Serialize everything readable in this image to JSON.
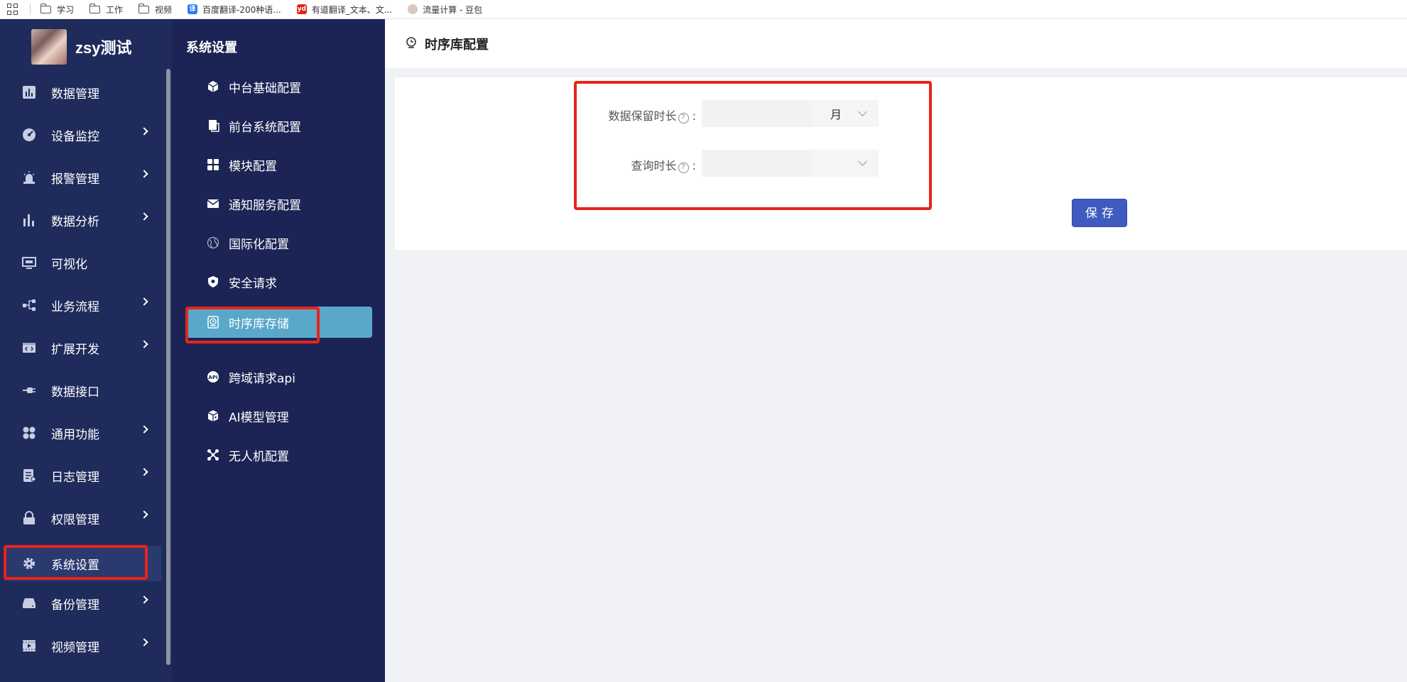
{
  "bookmarks": [
    {
      "label": "学习",
      "icon": "folder-icon"
    },
    {
      "label": "工作",
      "icon": "folder-icon"
    },
    {
      "label": "视频",
      "icon": "folder-icon"
    },
    {
      "label": "百度翻译-200种语...",
      "icon": "baidu-translate-icon"
    },
    {
      "label": "有道翻译_文本、文...",
      "icon": "youdao-icon"
    },
    {
      "label": "流量计算 - 豆包",
      "icon": "doubao-icon"
    }
  ],
  "brand": {
    "name": "zsy测试"
  },
  "sidebar": {
    "items": [
      {
        "label": "数据管理",
        "icon": "bar-chart-icon",
        "has_children": false
      },
      {
        "label": "设备监控",
        "icon": "gauge-icon",
        "has_children": true
      },
      {
        "label": "报警管理",
        "icon": "alarm-icon",
        "has_children": true
      },
      {
        "label": "数据分析",
        "icon": "analytics-icon",
        "has_children": true
      },
      {
        "label": "可视化",
        "icon": "monitor-icon",
        "has_children": false
      },
      {
        "label": "业务流程",
        "icon": "flow-icon",
        "has_children": true
      },
      {
        "label": "扩展开发",
        "icon": "code-icon",
        "has_children": true
      },
      {
        "label": "数据接口",
        "icon": "plug-icon",
        "has_children": false
      },
      {
        "label": "通用功能",
        "icon": "grid-icon",
        "has_children": true
      },
      {
        "label": "日志管理",
        "icon": "log-icon",
        "has_children": true
      },
      {
        "label": "权限管理",
        "icon": "lock-icon",
        "has_children": true
      },
      {
        "label": "系统设置",
        "icon": "gear-icon",
        "has_children": false,
        "active": true
      },
      {
        "label": "备份管理",
        "icon": "backup-icon",
        "has_children": true
      },
      {
        "label": "视频管理",
        "icon": "video-icon",
        "has_children": true
      }
    ]
  },
  "subnav": {
    "title": "系统设置",
    "items": [
      {
        "label": "中台基础配置",
        "icon": "cube-icon"
      },
      {
        "label": "前台系统配置",
        "icon": "document-icon"
      },
      {
        "label": "模块配置",
        "icon": "modules-icon"
      },
      {
        "label": "通知服务配置",
        "icon": "mail-icon"
      },
      {
        "label": "国际化配置",
        "icon": "globe-icon"
      },
      {
        "label": "安全请求",
        "icon": "shield-icon"
      },
      {
        "label": "时序库存储",
        "icon": "clock-storage-icon",
        "active": true
      },
      {
        "label": "跨域请求api",
        "icon": "api-icon"
      },
      {
        "label": "AI模型管理",
        "icon": "box-icon"
      },
      {
        "label": "无人机配置",
        "icon": "drone-icon"
      }
    ]
  },
  "main": {
    "title": "时序库配置",
    "form": {
      "retention_label": "数据保留时长",
      "retention_value": "",
      "retention_unit": "月",
      "query_label": "查询时长",
      "query_value": "",
      "query_unit": "",
      "colon": ":"
    },
    "save_label": "保存"
  },
  "colors": {
    "sidebar_bg": "#1f2b5b",
    "subnav_bg": "#1b2454",
    "active_sub_bg": "#5aa8c9",
    "primary_button": "#3f5bbf",
    "highlight_red": "#e8231b"
  }
}
